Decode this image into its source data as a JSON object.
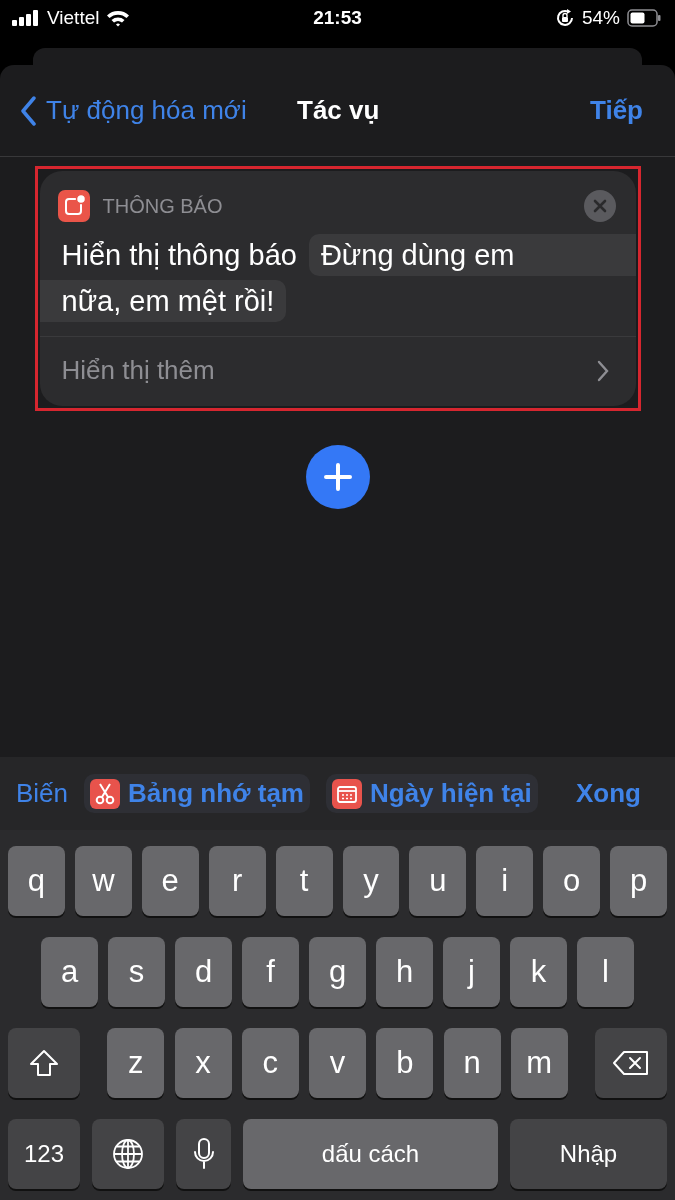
{
  "status_bar": {
    "carrier": "Viettel",
    "time": "21:53",
    "battery": "54%"
  },
  "nav": {
    "back": "Tự động hóa mới",
    "title": "Tác vụ",
    "next": "Tiếp"
  },
  "action": {
    "category": "THÔNG BÁO",
    "verb": "Hiển thị thông báo",
    "message_lines": [
      "Đừng dùng em",
      "nữa, em mệt rồi!"
    ],
    "more": "Hiển thị thêm"
  },
  "toolbar": {
    "variables": "Biến",
    "chips": [
      {
        "label": "Bảng nhớ tạm",
        "kind": "clipboard"
      },
      {
        "label": "Ngày hiện tại",
        "kind": "date"
      }
    ],
    "done": "Xong"
  },
  "keyboard": {
    "rows": [
      [
        "q",
        "w",
        "e",
        "r",
        "t",
        "y",
        "u",
        "i",
        "o",
        "p"
      ],
      [
        "a",
        "s",
        "d",
        "f",
        "g",
        "h",
        "j",
        "k",
        "l"
      ],
      [
        "z",
        "x",
        "c",
        "v",
        "b",
        "n",
        "m"
      ]
    ],
    "numbers": "123",
    "space": "dấu cách",
    "return": "Nhập"
  }
}
